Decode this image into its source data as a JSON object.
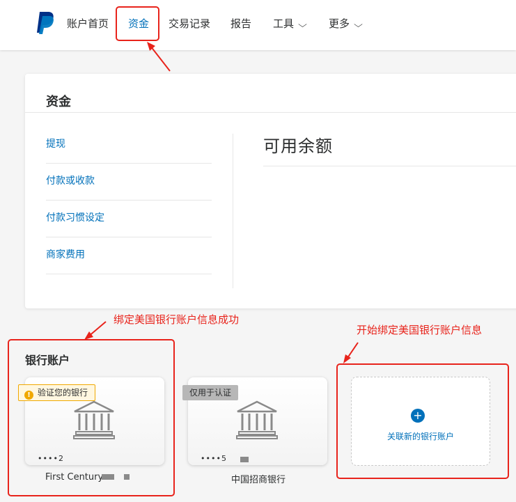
{
  "nav": {
    "items": [
      {
        "label": "账户首页"
      },
      {
        "label": "资金"
      },
      {
        "label": "交易记录"
      },
      {
        "label": "报告"
      },
      {
        "label": "工具"
      },
      {
        "label": "更多"
      }
    ],
    "active": "资金"
  },
  "funds": {
    "title": "资金",
    "menu": [
      "提现",
      "付款或收款",
      "付款习惯设定",
      "商家费用"
    ],
    "balance_title": "可用余额"
  },
  "annotations": {
    "bound_success": "绑定美国银行账户信息成功",
    "start_binding": "开始绑定美国银行账户信息"
  },
  "bank": {
    "heading": "银行账户",
    "cards": [
      {
        "tag": "验证您的银行",
        "masked": "••••2",
        "name": "First Century"
      },
      {
        "tag": "仅用于认证",
        "masked": "••••5",
        "name": "中国招商银行"
      }
    ],
    "add_label": "关联新的银行账户"
  },
  "colors": {
    "accent": "#0070ba",
    "annotation_red": "#e8231b",
    "warn": "#f0a800"
  }
}
